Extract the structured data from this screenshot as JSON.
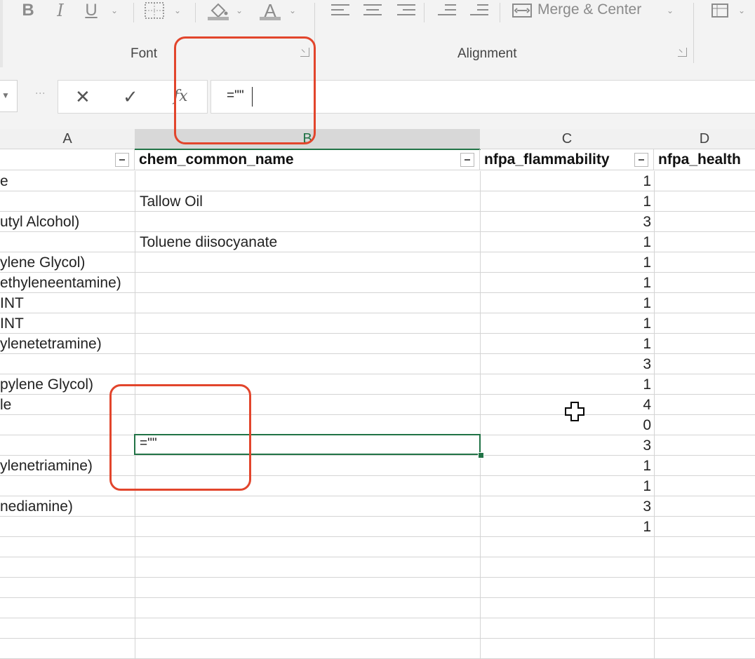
{
  "ribbon": {
    "groups": {
      "font_label": "Font",
      "alignment_label": "Alignment"
    },
    "merge_center_label": "Merge & Center",
    "icons": [
      "bold-icon",
      "italic-icon",
      "underline-icon",
      "borders-icon",
      "fill-color-icon",
      "font-color-icon",
      "align-left-icon",
      "align-center-icon",
      "align-right-icon",
      "decrease-indent-icon",
      "increase-indent-icon",
      "merge-center-icon",
      "conditional-format-icon"
    ],
    "bold_glyph": "B",
    "italic_glyph": "I",
    "underline_glyph": "U",
    "fontcolor_glyph": "A"
  },
  "formula_bar": {
    "cancel_glyph": "✕",
    "enter_glyph": "✓",
    "fx_glyph": "fx",
    "value": "=\"\""
  },
  "columns": [
    {
      "letter": "A",
      "header": ""
    },
    {
      "letter": "B",
      "header": "chem_common_name"
    },
    {
      "letter": "C",
      "header": "nfpa_flammability"
    },
    {
      "letter": "D",
      "header": "nfpa_health"
    }
  ],
  "rows": [
    {
      "a": "e",
      "b": "",
      "c": "1"
    },
    {
      "a": "",
      "b": "Tallow Oil",
      "c": "1"
    },
    {
      "a": "utyl Alcohol)",
      "b": "",
      "c": "3"
    },
    {
      "a": "",
      "b": "Toluene diisocyanate",
      "c": "1"
    },
    {
      "a": "ylene Glycol)",
      "b": "",
      "c": "1"
    },
    {
      "a": "ethyleneentamine)",
      "b": "",
      "c": "1"
    },
    {
      "a": "INT",
      "b": "",
      "c": "1"
    },
    {
      "a": "INT",
      "b": "",
      "c": "1"
    },
    {
      "a": "ylenetetramine)",
      "b": "",
      "c": "1"
    },
    {
      "a": "",
      "b": "",
      "c": "3"
    },
    {
      "a": "pylene Glycol)",
      "b": "",
      "c": "1"
    },
    {
      "a": "le",
      "b": "",
      "c": "4"
    },
    {
      "a": "",
      "b": "",
      "c": "0"
    },
    {
      "a": "",
      "b": "",
      "c": "3"
    },
    {
      "a": "ylenetriamine)",
      "b": "",
      "c": "1"
    },
    {
      "a": "",
      "b": "",
      "c": "1"
    },
    {
      "a": "nediamine)",
      "b": "",
      "c": "3"
    },
    {
      "a": "",
      "b": "",
      "c": "1"
    },
    {
      "a": "",
      "b": "",
      "c": ""
    },
    {
      "a": "",
      "b": "",
      "c": ""
    },
    {
      "a": "",
      "b": "",
      "c": ""
    },
    {
      "a": "",
      "b": "",
      "c": ""
    },
    {
      "a": "",
      "b": "",
      "c": ""
    },
    {
      "a": "",
      "b": "",
      "c": ""
    }
  ],
  "active_cell_value": "=\"\"",
  "colors": {
    "accent": "#217346",
    "annotation": "#e2452c"
  }
}
